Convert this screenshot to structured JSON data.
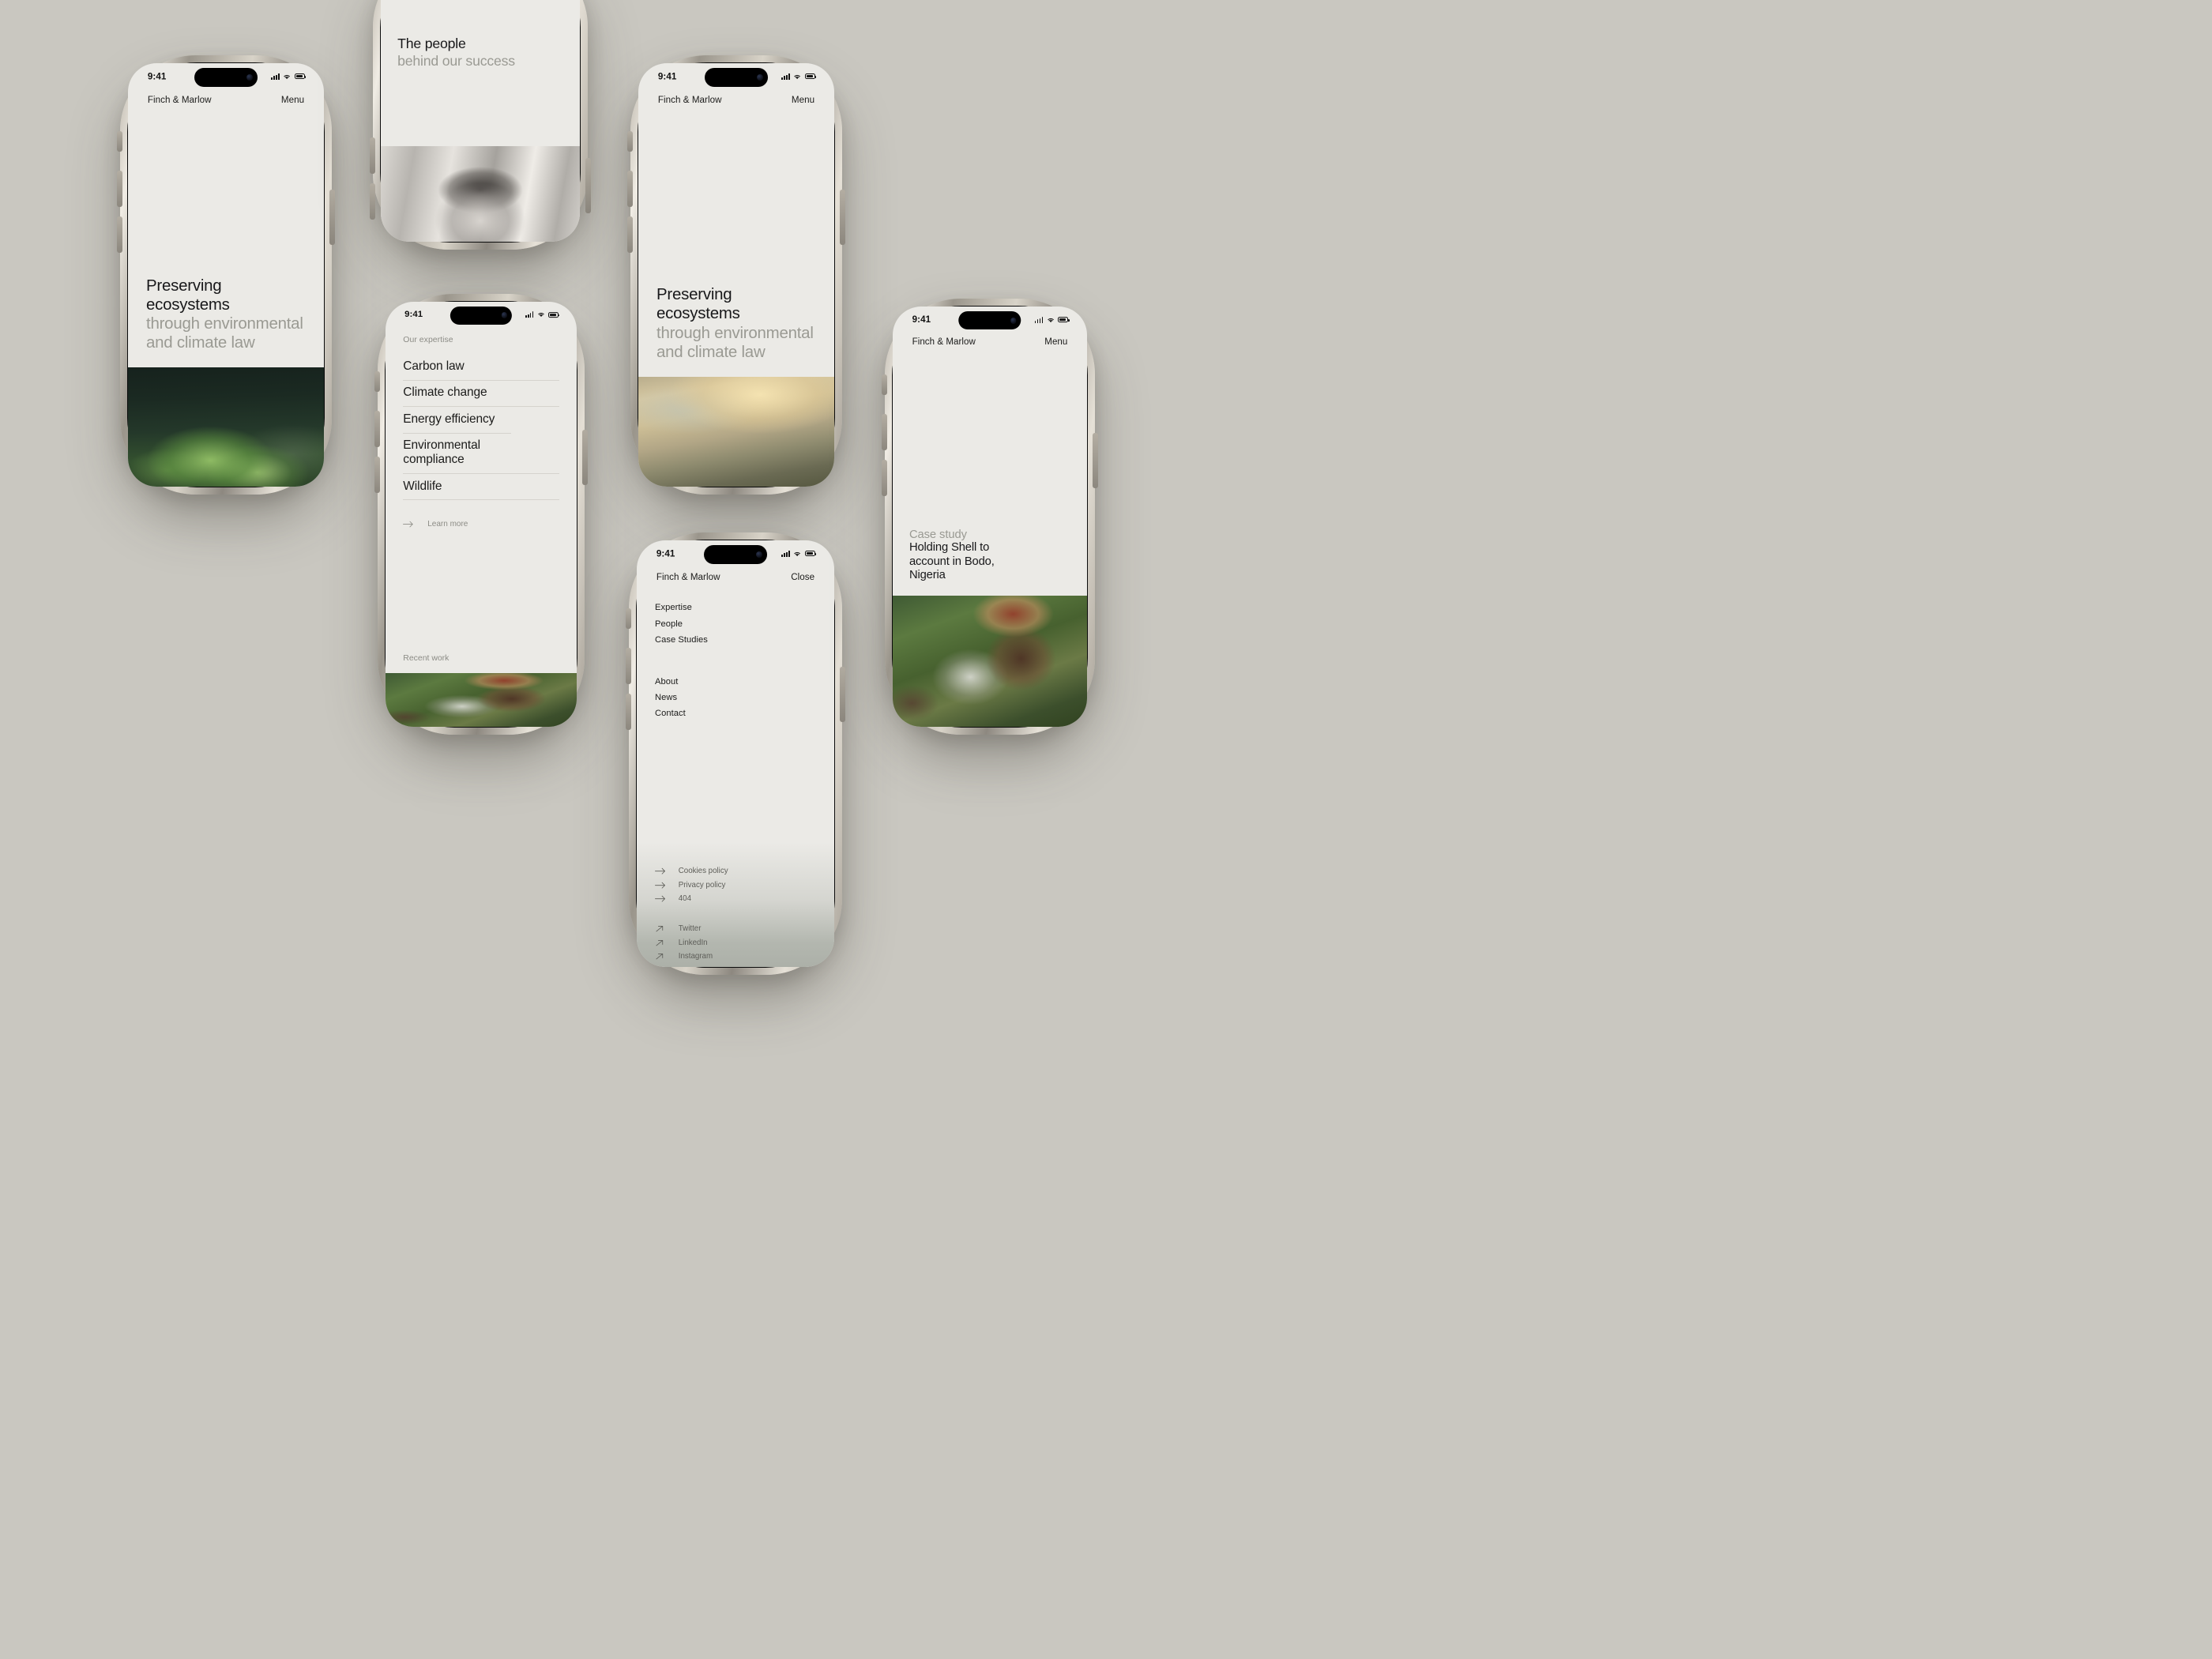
{
  "theme": {
    "canvas_bg": "#C9C7C0",
    "screen_bg": "#EBEAE6",
    "text_dark": "#18181A",
    "text_muted": "#9A9A93",
    "divider": "#D5D3CD"
  },
  "status_bar": {
    "time": "9:41",
    "signal_icon": "cellular-bars-icon",
    "wifi_icon": "wifi-icon",
    "battery_icon": "battery-icon"
  },
  "brand": {
    "name": "Finch & Marlow"
  },
  "screens": {
    "home_forest": {
      "header": {
        "brand": "Finch & Marlow",
        "action": "Menu"
      },
      "hero": {
        "line1": "Preserving ecosystems",
        "line2": "through environmental",
        "line3": "and climate law"
      },
      "image": "forest-seedling-photo"
    },
    "people": {
      "hero": {
        "line1": "The people",
        "line2": "behind our success"
      },
      "image": "portrait-black-and-white-photo"
    },
    "expertise": {
      "eyebrow": "Our expertise",
      "items": [
        {
          "label": "Carbon law"
        },
        {
          "label": "Climate change"
        },
        {
          "label": "Energy efficiency"
        },
        {
          "label": "Environmental compliance"
        },
        {
          "label": "Wildlife"
        }
      ],
      "learn_more": {
        "label": "Learn more",
        "icon": "arrow-right-icon"
      },
      "recent_work_label": "Recent work",
      "image": "woman-with-child-photo"
    },
    "home_mountain": {
      "header": {
        "brand": "Finch & Marlow",
        "action": "Menu"
      },
      "hero": {
        "line1": "Preserving ecosystems",
        "line2": "through environmental",
        "line3": "and climate law"
      },
      "image": "golden-mountain-valley-photo"
    },
    "menu": {
      "header": {
        "brand": "Finch & Marlow",
        "action": "Close"
      },
      "primary_nav": [
        {
          "label": "Expertise"
        },
        {
          "label": "People"
        },
        {
          "label": "Case Studies"
        }
      ],
      "secondary_nav": [
        {
          "label": "About"
        },
        {
          "label": "News"
        },
        {
          "label": "Contact"
        }
      ],
      "policy_links": [
        {
          "label": "Cookies policy",
          "icon": "arrow-right-icon"
        },
        {
          "label": "Privacy policy",
          "icon": "arrow-right-icon"
        },
        {
          "label": "404",
          "icon": "arrow-right-icon"
        }
      ],
      "social_links": [
        {
          "label": "Twitter",
          "icon": "arrow-up-right-icon"
        },
        {
          "label": "LinkedIn",
          "icon": "arrow-up-right-icon"
        },
        {
          "label": "Instagram",
          "icon": "arrow-up-right-icon"
        }
      ]
    },
    "case_study": {
      "header": {
        "brand": "Finch & Marlow",
        "action": "Menu"
      },
      "label": "Case study",
      "title_line1": "Holding Shell to",
      "title_line2": "account in Bodo,",
      "title_line3": "Nigeria",
      "image": "woman-with-child-photo"
    }
  }
}
